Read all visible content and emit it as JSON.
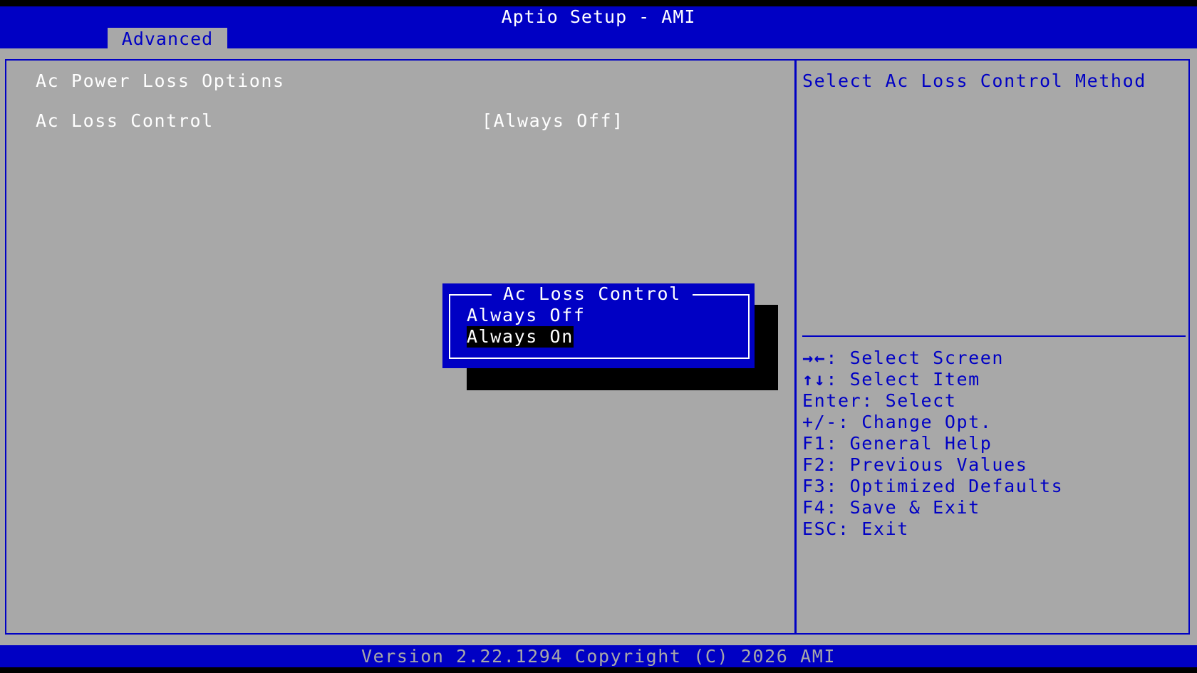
{
  "header": {
    "title": "Aptio Setup - AMI"
  },
  "tabs": [
    {
      "label": "Advanced",
      "active": true
    }
  ],
  "main": {
    "section_title": "Ac Power Loss Options",
    "settings": [
      {
        "label": "Ac Loss Control",
        "value": "[Always Off]"
      }
    ]
  },
  "help_panel": {
    "description": "Select Ac Loss Control Method",
    "keys": [
      {
        "key": "→←",
        "action": ": Select Screen"
      },
      {
        "key": "↑↓",
        "action": ": Select Item"
      },
      {
        "key": "Enter",
        "action": ": Select"
      },
      {
        "key": "+/-",
        "action": ": Change Opt."
      },
      {
        "key": "F1",
        "action": ": General Help"
      },
      {
        "key": "F2",
        "action": ": Previous Values"
      },
      {
        "key": "F3",
        "action": ": Optimized Defaults"
      },
      {
        "key": "F4",
        "action": ": Save & Exit"
      },
      {
        "key": "ESC",
        "action": ": Exit"
      }
    ]
  },
  "popup": {
    "title": "Ac Loss Control",
    "options": [
      {
        "label": "Always Off",
        "highlighted": false
      },
      {
        "label": "Always On",
        "highlighted": true
      }
    ]
  },
  "footer": {
    "version": "Version 2.22.1294 Copyright (C) 2026 AMI"
  },
  "colors": {
    "bios_blue": "#0000c4",
    "panel_gray": "#a8a8a8",
    "text_white": "#ffffff",
    "selection_black": "#000000"
  }
}
